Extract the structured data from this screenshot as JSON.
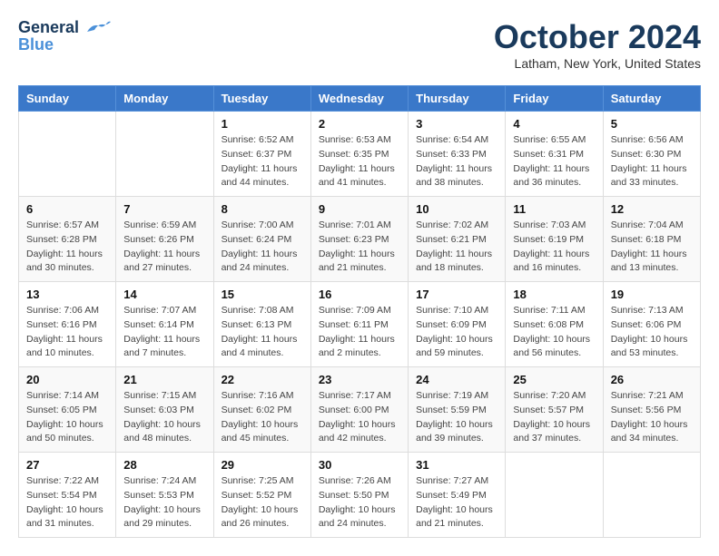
{
  "header": {
    "logo_line1": "General",
    "logo_line2": "Blue",
    "month": "October 2024",
    "location": "Latham, New York, United States"
  },
  "weekdays": [
    "Sunday",
    "Monday",
    "Tuesday",
    "Wednesday",
    "Thursday",
    "Friday",
    "Saturday"
  ],
  "weeks": [
    [
      {
        "day": "",
        "detail": ""
      },
      {
        "day": "",
        "detail": ""
      },
      {
        "day": "1",
        "detail": "Sunrise: 6:52 AM\nSunset: 6:37 PM\nDaylight: 11 hours and 44 minutes."
      },
      {
        "day": "2",
        "detail": "Sunrise: 6:53 AM\nSunset: 6:35 PM\nDaylight: 11 hours and 41 minutes."
      },
      {
        "day": "3",
        "detail": "Sunrise: 6:54 AM\nSunset: 6:33 PM\nDaylight: 11 hours and 38 minutes."
      },
      {
        "day": "4",
        "detail": "Sunrise: 6:55 AM\nSunset: 6:31 PM\nDaylight: 11 hours and 36 minutes."
      },
      {
        "day": "5",
        "detail": "Sunrise: 6:56 AM\nSunset: 6:30 PM\nDaylight: 11 hours and 33 minutes."
      }
    ],
    [
      {
        "day": "6",
        "detail": "Sunrise: 6:57 AM\nSunset: 6:28 PM\nDaylight: 11 hours and 30 minutes."
      },
      {
        "day": "7",
        "detail": "Sunrise: 6:59 AM\nSunset: 6:26 PM\nDaylight: 11 hours and 27 minutes."
      },
      {
        "day": "8",
        "detail": "Sunrise: 7:00 AM\nSunset: 6:24 PM\nDaylight: 11 hours and 24 minutes."
      },
      {
        "day": "9",
        "detail": "Sunrise: 7:01 AM\nSunset: 6:23 PM\nDaylight: 11 hours and 21 minutes."
      },
      {
        "day": "10",
        "detail": "Sunrise: 7:02 AM\nSunset: 6:21 PM\nDaylight: 11 hours and 18 minutes."
      },
      {
        "day": "11",
        "detail": "Sunrise: 7:03 AM\nSunset: 6:19 PM\nDaylight: 11 hours and 16 minutes."
      },
      {
        "day": "12",
        "detail": "Sunrise: 7:04 AM\nSunset: 6:18 PM\nDaylight: 11 hours and 13 minutes."
      }
    ],
    [
      {
        "day": "13",
        "detail": "Sunrise: 7:06 AM\nSunset: 6:16 PM\nDaylight: 11 hours and 10 minutes."
      },
      {
        "day": "14",
        "detail": "Sunrise: 7:07 AM\nSunset: 6:14 PM\nDaylight: 11 hours and 7 minutes."
      },
      {
        "day": "15",
        "detail": "Sunrise: 7:08 AM\nSunset: 6:13 PM\nDaylight: 11 hours and 4 minutes."
      },
      {
        "day": "16",
        "detail": "Sunrise: 7:09 AM\nSunset: 6:11 PM\nDaylight: 11 hours and 2 minutes."
      },
      {
        "day": "17",
        "detail": "Sunrise: 7:10 AM\nSunset: 6:09 PM\nDaylight: 10 hours and 59 minutes."
      },
      {
        "day": "18",
        "detail": "Sunrise: 7:11 AM\nSunset: 6:08 PM\nDaylight: 10 hours and 56 minutes."
      },
      {
        "day": "19",
        "detail": "Sunrise: 7:13 AM\nSunset: 6:06 PM\nDaylight: 10 hours and 53 minutes."
      }
    ],
    [
      {
        "day": "20",
        "detail": "Sunrise: 7:14 AM\nSunset: 6:05 PM\nDaylight: 10 hours and 50 minutes."
      },
      {
        "day": "21",
        "detail": "Sunrise: 7:15 AM\nSunset: 6:03 PM\nDaylight: 10 hours and 48 minutes."
      },
      {
        "day": "22",
        "detail": "Sunrise: 7:16 AM\nSunset: 6:02 PM\nDaylight: 10 hours and 45 minutes."
      },
      {
        "day": "23",
        "detail": "Sunrise: 7:17 AM\nSunset: 6:00 PM\nDaylight: 10 hours and 42 minutes."
      },
      {
        "day": "24",
        "detail": "Sunrise: 7:19 AM\nSunset: 5:59 PM\nDaylight: 10 hours and 39 minutes."
      },
      {
        "day": "25",
        "detail": "Sunrise: 7:20 AM\nSunset: 5:57 PM\nDaylight: 10 hours and 37 minutes."
      },
      {
        "day": "26",
        "detail": "Sunrise: 7:21 AM\nSunset: 5:56 PM\nDaylight: 10 hours and 34 minutes."
      }
    ],
    [
      {
        "day": "27",
        "detail": "Sunrise: 7:22 AM\nSunset: 5:54 PM\nDaylight: 10 hours and 31 minutes."
      },
      {
        "day": "28",
        "detail": "Sunrise: 7:24 AM\nSunset: 5:53 PM\nDaylight: 10 hours and 29 minutes."
      },
      {
        "day": "29",
        "detail": "Sunrise: 7:25 AM\nSunset: 5:52 PM\nDaylight: 10 hours and 26 minutes."
      },
      {
        "day": "30",
        "detail": "Sunrise: 7:26 AM\nSunset: 5:50 PM\nDaylight: 10 hours and 24 minutes."
      },
      {
        "day": "31",
        "detail": "Sunrise: 7:27 AM\nSunset: 5:49 PM\nDaylight: 10 hours and 21 minutes."
      },
      {
        "day": "",
        "detail": ""
      },
      {
        "day": "",
        "detail": ""
      }
    ]
  ]
}
